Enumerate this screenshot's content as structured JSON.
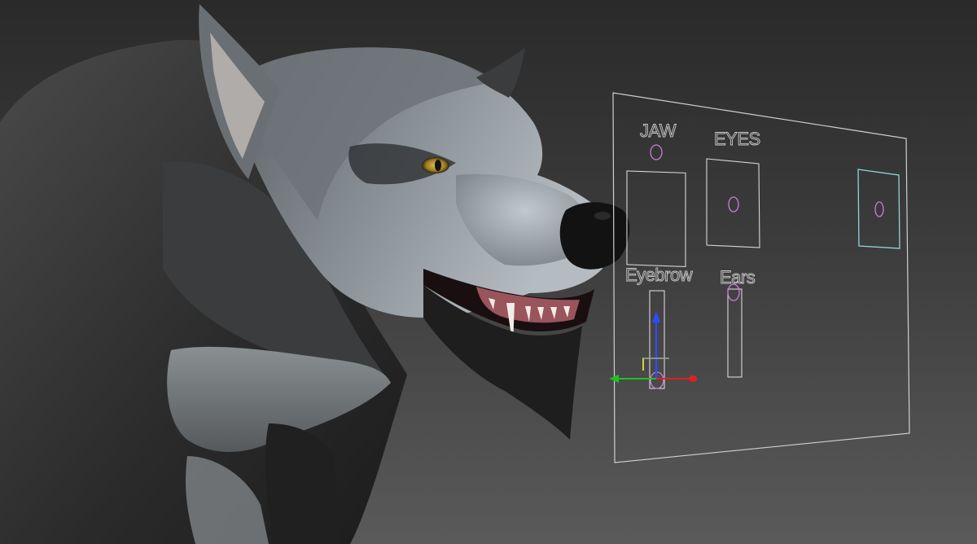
{
  "rig_panel": {
    "labels": {
      "jaw": "JAW",
      "eyes": "EYES",
      "eyebrow": "Eyebrow",
      "ears": "Ears"
    }
  },
  "icons": {
    "gizmo": "transform-gizmo-icon"
  },
  "colors": {
    "panel_line": "#d0d0d0",
    "handle_circle": "#c77fd6",
    "selected_box": "#8fd6d6",
    "gizmo_z": "#2e4bff",
    "gizmo_x": "#e02020",
    "gizmo_y": "#20c020",
    "gizmo_plane": "#ffff40"
  }
}
